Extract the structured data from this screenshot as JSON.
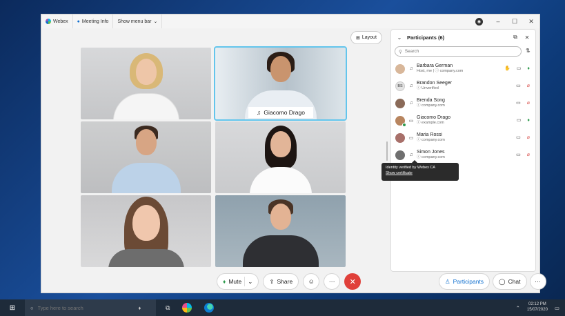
{
  "titlebar": {
    "app_name": "Webex",
    "meeting_info": "Meeting Info",
    "show_menu_bar": "Show menu bar"
  },
  "layout_button": {
    "label": "Layout"
  },
  "tiles": [
    {
      "name": "",
      "active": false
    },
    {
      "name": "Giacomo Drago",
      "active": true
    },
    {
      "name": "",
      "active": false
    },
    {
      "name": "",
      "active": false
    },
    {
      "name": "",
      "active": false
    },
    {
      "name": "",
      "active": false
    }
  ],
  "panel": {
    "title": "Participants (6)",
    "search_placeholder": "Search",
    "participants": [
      {
        "name": "Barbara German",
        "sub": "Host, me",
        "domain": "company.com",
        "initials": "",
        "mic": "on",
        "presence": false
      },
      {
        "name": "Brandon Seeger",
        "sub": "Unverified",
        "domain": "",
        "initials": "BS",
        "mic": "off",
        "presence": false
      },
      {
        "name": "Brenda Song",
        "sub": "",
        "domain": "company.com",
        "initials": "",
        "mic": "off",
        "presence": false
      },
      {
        "name": "Giacomo Drago",
        "sub": "",
        "domain": "example.com",
        "initials": "",
        "mic": "on",
        "presence": true
      },
      {
        "name": "Maria Rossi",
        "sub": "",
        "domain": "company.com",
        "initials": "",
        "mic": "off",
        "presence": false
      },
      {
        "name": "Simon Jones",
        "sub": "",
        "domain": "company.com",
        "initials": "",
        "mic": "off",
        "presence": false
      }
    ]
  },
  "tooltip": {
    "text": "Identity verified by Webex CA",
    "link": "Show certificate"
  },
  "controls": {
    "mute": "Mute",
    "share": "Share",
    "participants": "Participants",
    "chat": "Chat"
  },
  "taskbar": {
    "search_placeholder": "Type here to search",
    "time": "02:12 PM",
    "date": "15/07/2020"
  },
  "colors": {
    "accent": "#1170cf",
    "end_call": "#e0403a",
    "active_tile": "#63c5ec",
    "mic_on": "#2d9a4c",
    "mic_off": "#d9534f"
  }
}
